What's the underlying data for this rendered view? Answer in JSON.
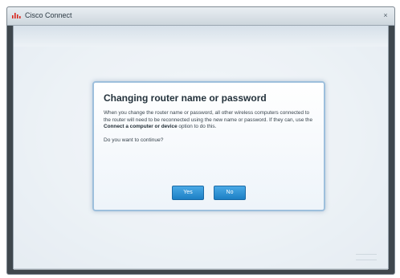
{
  "window": {
    "title": "Cisco Connect",
    "close_glyph": "×"
  },
  "dialog": {
    "title": "Changing router name or password",
    "body_text_1": "When you change the router name or password, all other wireless computers connected to the router will need to be reconnected using the new name or password. If they can, use the ",
    "body_bold": "Connect a computer or device",
    "body_text_2": " option to do this.",
    "question": "Do you want to continue?",
    "yes_label": "Yes",
    "no_label": "No"
  },
  "colors": {
    "button_blue": "#1c7fc4",
    "app_icon_red": "#d9261c"
  },
  "icons": {
    "app": "cisco-app-icon",
    "close": "close-icon"
  }
}
